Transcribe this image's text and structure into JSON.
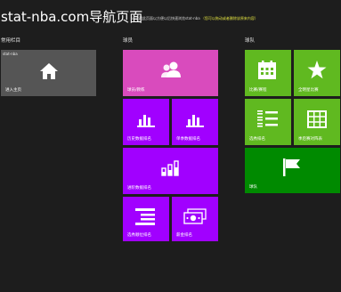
{
  "page": {
    "title": "stat-nba.com导航页面",
    "subtitle": "请收藏此页面以方便以后快速浏览stat-nba",
    "subtitle_note": "（您可以拖动或者删除该原来内容）"
  },
  "groups": {
    "common": {
      "label": "常用栏目",
      "tiles": [
        {
          "tag": "stat-nba",
          "label": "进入主页",
          "icon": "home-icon",
          "color": "#555555"
        }
      ]
    },
    "players": {
      "label": "球员",
      "tiles": [
        {
          "label": "球员/教练",
          "icon": "people-icon",
          "color": "#d94bbd"
        },
        {
          "label": "历史数据排名",
          "icon": "bar-chart-icon",
          "color": "#a100ff"
        },
        {
          "label": "单季数据排名",
          "icon": "bar-chart-icon",
          "color": "#a100ff"
        },
        {
          "label": "进阶数据排名",
          "icon": "bar-ladder-icon",
          "color": "#a100ff"
        },
        {
          "label": "选秀顺位排名",
          "icon": "lines-icon",
          "color": "#a100ff"
        },
        {
          "label": "薪金排名",
          "icon": "money-icon",
          "color": "#a100ff"
        }
      ]
    },
    "teams": {
      "label": "球队",
      "tiles": [
        {
          "label": "比赛/赛程",
          "icon": "calendar-icon",
          "color": "#60b920"
        },
        {
          "label": "全明星比赛",
          "icon": "star-icon",
          "color": "#60b920"
        },
        {
          "label": "选秀排名",
          "icon": "numbered-list-icon",
          "color": "#60b920"
        },
        {
          "label": "季后赛对阵表",
          "icon": "grid-icon",
          "color": "#60b920"
        },
        {
          "label": "球队",
          "icon": "flag-icon",
          "color": "#008a00"
        }
      ]
    }
  }
}
